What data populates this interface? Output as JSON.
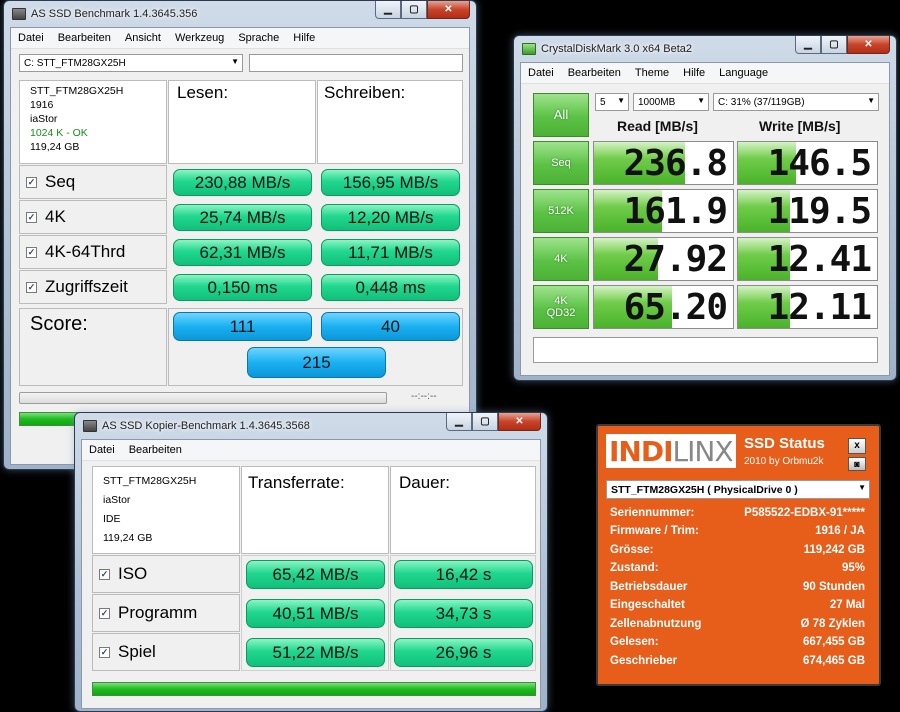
{
  "asssd": {
    "title": "AS SSD Benchmark 1.4.3645.356",
    "menu": [
      "Datei",
      "Bearbeiten",
      "Ansicht",
      "Werkzeug",
      "Sprache",
      "Hilfe"
    ],
    "drive_select": "C: STT_FTM28GX25H",
    "drive_info": {
      "model": "STT_FTM28GX25H",
      "firmware": "1916",
      "driver": "iaStor",
      "alignment": "1024 K - OK",
      "size": "119,24 GB"
    },
    "col_read": "Lesen:",
    "col_write": "Schreiben:",
    "rows": [
      {
        "label": "Seq",
        "read": "230,88 MB/s",
        "write": "156,95 MB/s"
      },
      {
        "label": "4K",
        "read": "25,74 MB/s",
        "write": "12,20 MB/s"
      },
      {
        "label": "4K-64Thrd",
        "read": "62,31 MB/s",
        "write": "11,71 MB/s"
      },
      {
        "label": "Zugriffszeit",
        "read": "0,150 ms",
        "write": "0,448 ms"
      }
    ],
    "score_label": "Score:",
    "score_read": "111",
    "score_write": "40",
    "score_total": "215",
    "time_display": "--:--:--"
  },
  "cdm": {
    "title": "CrystalDiskMark 3.0 x64 Beta2",
    "menu": [
      "Datei",
      "Bearbeiten",
      "Theme",
      "Hilfe",
      "Language"
    ],
    "all_label": "All",
    "runs": "5",
    "size": "1000MB",
    "drive": "C: 31% (37/119GB)",
    "read_header": "Read [MB/s]",
    "write_header": "Write [MB/s]",
    "rows": [
      {
        "label": "Seq",
        "read": "236.8",
        "write": "146.5"
      },
      {
        "label": "512K",
        "read": "161.9",
        "write": "119.5"
      },
      {
        "label": "4K",
        "read": "27.92",
        "write": "12.41"
      },
      {
        "label": "4K\nQD32",
        "read": "65.20",
        "write": "12.11"
      }
    ]
  },
  "copy": {
    "title": "AS SSD Kopier-Benchmark 1.4.3645.3568",
    "menu": [
      "Datei",
      "Bearbeiten"
    ],
    "drive_info": {
      "model": "STT_FTM28GX25H",
      "driver": "iaStor",
      "mode": "IDE",
      "size": "119,24 GB"
    },
    "col_rate": "Transferrate:",
    "col_time": "Dauer:",
    "rows": [
      {
        "label": "ISO",
        "rate": "65,42 MB/s",
        "time": "16,42 s"
      },
      {
        "label": "Programm",
        "rate": "40,51 MB/s",
        "time": "34,73 s"
      },
      {
        "label": "Spiel",
        "rate": "51,22 MB/s",
        "time": "26,96 s"
      }
    ]
  },
  "indilinx": {
    "logo_a": "INDI",
    "logo_b": "LINX",
    "title": "SSD Status",
    "subtitle": "2010 by Orbmu2k",
    "drive": "STT_FTM28GX25H ( PhysicalDrive 0 )",
    "rows": [
      {
        "k": "Seriennummer:",
        "v": "P585522-EDBX-91*****"
      },
      {
        "k": "Firmware / Trim:",
        "v": "1916 / JA"
      },
      {
        "k": "Grösse:",
        "v": "119,242 GB"
      },
      {
        "k": "Zustand:",
        "v": "95%"
      },
      {
        "k": "Betriebsdauer",
        "v": "90 Stunden"
      },
      {
        "k": "Eingeschaltet",
        "v": "27 Mal"
      },
      {
        "k": "Zellenabnutzung",
        "v": "Ø 78 Zyklen"
      },
      {
        "k": "Gelesen:",
        "v": "667,455 GB"
      },
      {
        "k": "Geschrieber",
        "v": "674,465 GB"
      }
    ],
    "close_label": "x"
  }
}
